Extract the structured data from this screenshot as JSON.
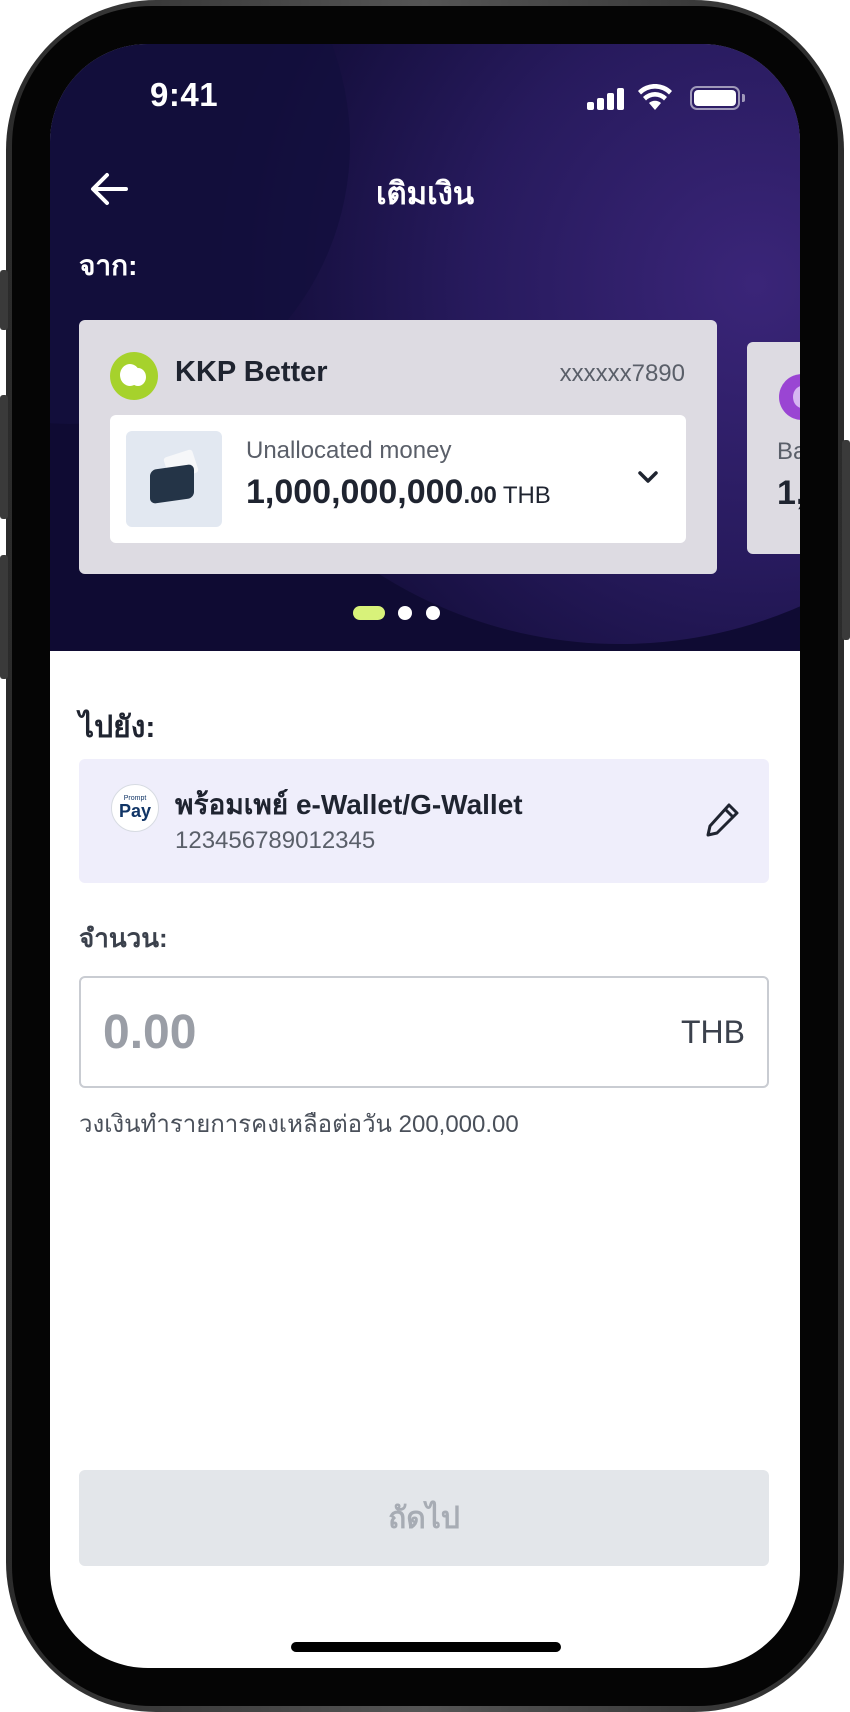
{
  "status_bar": {
    "time": "9:41"
  },
  "nav": {
    "title": "เติมเงิน"
  },
  "from": {
    "label": "จาก:",
    "account": {
      "name": "KKP Better",
      "number": "xxxxxx7890",
      "balance_label": "Unallocated money",
      "balance_int": "1,000,000,000",
      "balance_dec": ".00",
      "currency": "THB",
      "logo_color": "#a6d22c"
    },
    "next_account": {
      "label_partial": "Ba",
      "value_partial": "1,",
      "logo_color": "#9a45d3"
    },
    "pager": {
      "count": 3,
      "active": 0,
      "active_color": "#d8f27a"
    }
  },
  "to": {
    "label": "ไปยัง:",
    "destination": {
      "logo_top": "Prompt",
      "logo_main": "Pay",
      "name": "พร้อมเพย์ e-Wallet/G-Wallet",
      "number": "123456789012345"
    }
  },
  "amount": {
    "label": "จำนวน:",
    "placeholder": "0.00",
    "currency": "THB",
    "limit_text": "วงเงินทำรายการคงเหลือต่อวัน 200,000.00"
  },
  "actions": {
    "next_label": "ถัดไป"
  },
  "colors": {
    "header_bg": "#0f0b33",
    "card_bg": "#dddbe2",
    "destination_bg": "#efeefb",
    "button_disabled_bg": "#e3e6ea"
  }
}
